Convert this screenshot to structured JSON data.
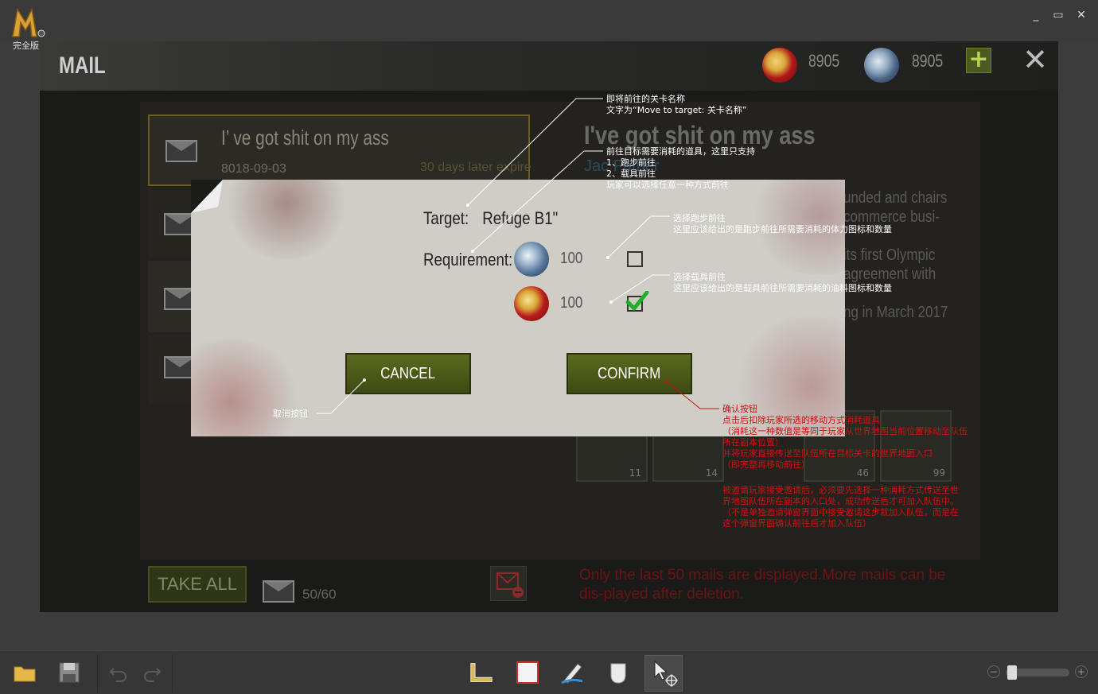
{
  "window": {
    "logo_text": "完全版",
    "minimize": "_",
    "maximize": "▭",
    "close": "✕"
  },
  "game": {
    "title": "MAIL",
    "currency_red": "8905",
    "currency_blue": "8905",
    "add_label": "+",
    "close_label": "✕",
    "mail": {
      "subject": "I’  ve got shit on my ass",
      "date": "8018-09-03",
      "expire": "30 days later expire"
    },
    "detail": {
      "title": "I've got shit on my ass",
      "from": "Jac        Father",
      "lines": [
        "unded and chairs",
        "commerce busi-",
        "its first Olympic",
        "agreement with",
        "ng in March 2017"
      ]
    },
    "rewards": [
      "11",
      "14",
      "46",
      "99"
    ],
    "take_all": "TAKE ALL",
    "mail_count": "50/60",
    "notice": "Only the last 50 mails are displayed.More mails can be dis-played after deletion."
  },
  "dialog": {
    "target_label": "Target:",
    "target_value": "Refuge B1\"",
    "requirement_label": "Requirement:",
    "walk_cost": "100",
    "vehicle_cost": "100",
    "walk_checked": false,
    "vehicle_checked": true,
    "cancel": "CANCEL",
    "confirm": "CONFIRM"
  },
  "annotations": {
    "target_note": [
      "即将前往的关卡名称",
      "文字为“Move to target: 关卡名称”"
    ],
    "requirement_note": [
      "前往目标需要消耗的道具，这里只支持",
      "1、跑步前往",
      "2、载具前往",
      "玩家可以选择任意一种方式前往"
    ],
    "walk_note": [
      "选择跑步前往",
      "这里应该给出的是跑步前往所需要消耗的体力图标和数量"
    ],
    "vehicle_note": [
      "选择载具前往",
      "这里应该给出的是载具前往所需要消耗的油料图标和数量"
    ],
    "cancel_note": "取消按钮",
    "confirm_note": [
      "确认按钮",
      "点击后扣除玩家所选的移动方式消耗道具",
      "（消耗这一种数值是等同于玩家从世界地图当前位置移动至队伍",
      "所在副本位置）",
      "并将玩家直接传送至队伍所在目标关卡的世界地图入口",
      "（即完整再移动前往）"
    ],
    "confirm_note2": [
      "被邀请玩家接受邀请后，必须要先选择一种消耗方式传送至世",
      "界地图队伍所在副本的入口处，成功传送后才可加入队伍中。",
      "（不是单独邀请弹窗界面中接受邀请这步就加入队伍，而是在",
      "这个弹窗界面确认前往后才加入队伍）"
    ]
  },
  "toolbar": {
    "items": [
      "folder-icon",
      "save-icon",
      "undo-icon",
      "redo-icon",
      "ruler-icon",
      "rectangle-icon",
      "pen-icon",
      "shape-icon",
      "move-icon",
      "zoom-out-icon",
      "zoom-in-icon"
    ],
    "zoom_out": "−",
    "zoom_in": "+"
  }
}
